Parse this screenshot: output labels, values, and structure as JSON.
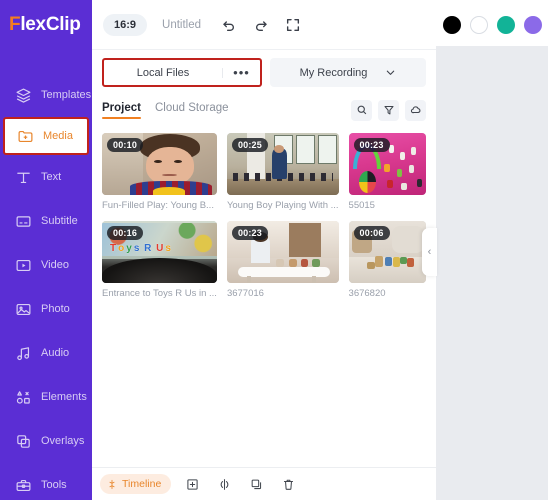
{
  "brand": {
    "logo_f": "F",
    "logo_rest": "lexClip",
    "accent_orange": "#f08021",
    "sidebar_purple": "#5b2ed4",
    "highlight_red": "#c0221d"
  },
  "sidebar": {
    "items": [
      {
        "label": "Templates",
        "icon": "layers-icon",
        "active": false
      },
      {
        "label": "Media",
        "icon": "folder-plus-icon",
        "active": true
      },
      {
        "label": "Text",
        "icon": "text-t-icon",
        "active": false
      },
      {
        "label": "Subtitle",
        "icon": "subtitle-icon",
        "active": false
      },
      {
        "label": "Video",
        "icon": "video-play-icon",
        "active": false
      },
      {
        "label": "Photo",
        "icon": "image-icon",
        "active": false
      },
      {
        "label": "Audio",
        "icon": "music-note-icon",
        "active": false
      },
      {
        "label": "Elements",
        "icon": "shapes-icon",
        "active": false
      },
      {
        "label": "Overlays",
        "icon": "overlay-squares-icon",
        "active": false
      },
      {
        "label": "Tools",
        "icon": "toolbox-icon",
        "active": false
      }
    ]
  },
  "topbar": {
    "aspect_ratio": "16:9",
    "project_title": "Untitled",
    "undo_icon": "undo-icon",
    "redo_icon": "redo-icon",
    "fullscreen_icon": "fullscreen-icon"
  },
  "source_row": {
    "local_files_label": "Local Files",
    "local_files_more": "•••",
    "recording_label": "My Recording",
    "recording_chevron": "chevron-down-icon"
  },
  "tabs": {
    "items": [
      {
        "label": "Project",
        "active": true
      },
      {
        "label": "Cloud Storage",
        "active": false
      }
    ],
    "actions": [
      {
        "name": "search-icon"
      },
      {
        "name": "filter-icon"
      },
      {
        "name": "cloud-icon"
      }
    ]
  },
  "media_items": [
    {
      "duration": "00:10",
      "caption": "Fun-Filled Play: Young B...",
      "scene": "sc1"
    },
    {
      "duration": "00:25",
      "caption": "Young Boy Playing With ...",
      "scene": "sc2"
    },
    {
      "duration": "00:23",
      "caption": "55015",
      "scene": "sc3"
    },
    {
      "duration": "00:16",
      "caption": "Entrance to Toys R Us in ...",
      "scene": "sc4"
    },
    {
      "duration": "00:23",
      "caption": "3677016",
      "scene": "sc5"
    },
    {
      "duration": "00:06",
      "caption": "3676820",
      "scene": "sc6"
    }
  ],
  "collapse_handle": {
    "glyph": "‹"
  },
  "bottombar": {
    "timeline_label": "Timeline",
    "timeline_icon": "timeline-icon",
    "buttons": [
      {
        "name": "add-media-button",
        "icon": "plus-square-icon"
      },
      {
        "name": "split-button",
        "icon": "split-icon"
      },
      {
        "name": "duplicate-button",
        "icon": "duplicate-icon"
      },
      {
        "name": "delete-button",
        "icon": "trash-icon"
      }
    ]
  },
  "swatches": [
    {
      "name": "swatch-black",
      "color": "#000000"
    },
    {
      "name": "swatch-white",
      "color": "#ffffff"
    },
    {
      "name": "swatch-teal",
      "color": "#12b397"
    },
    {
      "name": "swatch-purple",
      "color": "#8b6ae8"
    }
  ]
}
